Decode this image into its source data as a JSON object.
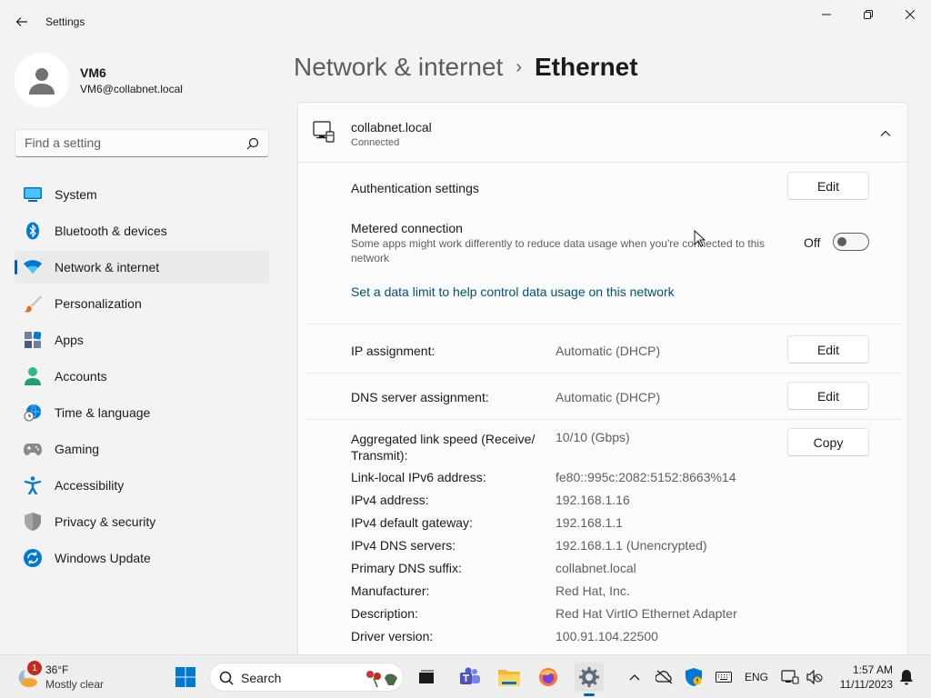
{
  "window": {
    "title": "Settings",
    "back_label": "Back",
    "minimize_label": "Minimize",
    "maximize_label": "Restore",
    "close_label": "Close"
  },
  "profile": {
    "name": "VM6",
    "email": "VM6@collabnet.local"
  },
  "search": {
    "placeholder": "Find a setting"
  },
  "sidebar": {
    "items": [
      {
        "label": "System",
        "icon": "system-icon"
      },
      {
        "label": "Bluetooth & devices",
        "icon": "bluetooth-icon"
      },
      {
        "label": "Network & internet",
        "icon": "wifi-icon",
        "selected": true
      },
      {
        "label": "Personalization",
        "icon": "brush-icon"
      },
      {
        "label": "Apps",
        "icon": "apps-icon"
      },
      {
        "label": "Accounts",
        "icon": "person-icon"
      },
      {
        "label": "Time & language",
        "icon": "globe-clock-icon"
      },
      {
        "label": "Gaming",
        "icon": "gamepad-icon"
      },
      {
        "label": "Accessibility",
        "icon": "accessibility-icon"
      },
      {
        "label": "Privacy & security",
        "icon": "shield-icon"
      },
      {
        "label": "Windows Update",
        "icon": "update-icon"
      }
    ]
  },
  "header": {
    "parent": "Network & internet",
    "separator": "›",
    "current": "Ethernet"
  },
  "network": {
    "name": "collabnet.local",
    "status": "Connected"
  },
  "settings": {
    "auth_label": "Authentication settings",
    "auth_button": "Edit",
    "metered_label": "Metered connection",
    "metered_desc": "Some apps might work differently to reduce data usage when you're connected to this network",
    "metered_state": "Off",
    "data_limit_link": "Set a data limit to help control data usage on this network",
    "ip_label": "IP assignment:",
    "ip_value": "Automatic (DHCP)",
    "ip_button": "Edit",
    "dns_label": "DNS server assignment:",
    "dns_value": "Automatic (DHCP)",
    "dns_button": "Edit",
    "copy_button": "Copy"
  },
  "properties": [
    {
      "label": "Aggregated link speed (Receive/ Transmit):",
      "value": "10/10 (Gbps)"
    },
    {
      "label": "Link-local IPv6 address:",
      "value": "fe80::995c:2082:5152:8663%14"
    },
    {
      "label": "IPv4 address:",
      "value": "192.168.1.16"
    },
    {
      "label": "IPv4 default gateway:",
      "value": "192.168.1.1"
    },
    {
      "label": "IPv4 DNS servers:",
      "value": "192.168.1.1 (Unencrypted)"
    },
    {
      "label": "Primary DNS suffix:",
      "value": "collabnet.local"
    },
    {
      "label": "Manufacturer:",
      "value": "Red Hat, Inc."
    },
    {
      "label": "Description:",
      "value": "Red Hat VirtIO Ethernet Adapter"
    },
    {
      "label": "Driver version:",
      "value": "100.91.104.22500"
    }
  ],
  "taskbar": {
    "weather_temp": "36°F",
    "weather_desc": "Mostly clear",
    "weather_badge": "1",
    "search_label": "Search",
    "language": "ENG",
    "time": "1:57 AM",
    "date": "11/11/2023"
  },
  "colors": {
    "accent": "#005fb8",
    "link": "#00507a",
    "background": "#f3f3f3",
    "card": "#fbfbfb"
  }
}
